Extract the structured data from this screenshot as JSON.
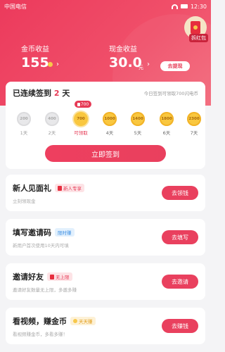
{
  "status_bar": {
    "carrier": "中国电信",
    "time": "12:30"
  },
  "header": {
    "red_packet_label": "拆红包",
    "coin_income_label": "金币收益",
    "coin_income_value": "155",
    "cash_income_label": "现金收益",
    "cash_income_value": "30.0",
    "cash_unit": "元",
    "withdraw_label": "去提现"
  },
  "checkin": {
    "title_prefix": "已连续签到",
    "streak_days": "2",
    "title_suffix": "天",
    "tip": "今日签到可领取700闪电币",
    "today_badge": "700",
    "days": [
      {
        "amount": "200",
        "label": "1天",
        "state": "done"
      },
      {
        "amount": "400",
        "label": "2天",
        "state": "done"
      },
      {
        "amount": "700",
        "label": "可领取",
        "state": "today"
      },
      {
        "amount": "1000",
        "label": "4天",
        "state": "future"
      },
      {
        "amount": "1400",
        "label": "5天",
        "state": "future"
      },
      {
        "amount": "1800",
        "label": "6天",
        "state": "future"
      },
      {
        "amount": "2300",
        "label": "7天",
        "state": "future"
      }
    ],
    "button_label": "立即签到"
  },
  "tasks": [
    {
      "title": "新人见面礼",
      "badge": "新人专享",
      "badge_style": "red",
      "badge_icon": "red-packet-icon",
      "desc": "立刻领现金",
      "button": "去领钱"
    },
    {
      "title": "填写邀请码",
      "badge": "限时赚",
      "badge_style": "blue",
      "badge_icon": "",
      "desc": "新用户首次使用10天内可填",
      "button": "去填写"
    },
    {
      "title": "邀请好友",
      "badge": "无上限",
      "badge_style": "red",
      "badge_icon": "red-packet-icon",
      "desc": "邀请好友数量无上限，多邀多赚",
      "button": "去邀请"
    },
    {
      "title": "看视频，赚金币",
      "badge": "天天赚",
      "badge_style": "yellow",
      "badge_icon": "coin-icon",
      "desc": "看视频赚金币，多看多赚！",
      "button": "去赚钱"
    }
  ],
  "colors": {
    "accent": "#e63a55",
    "coin": "#f9c73f"
  }
}
